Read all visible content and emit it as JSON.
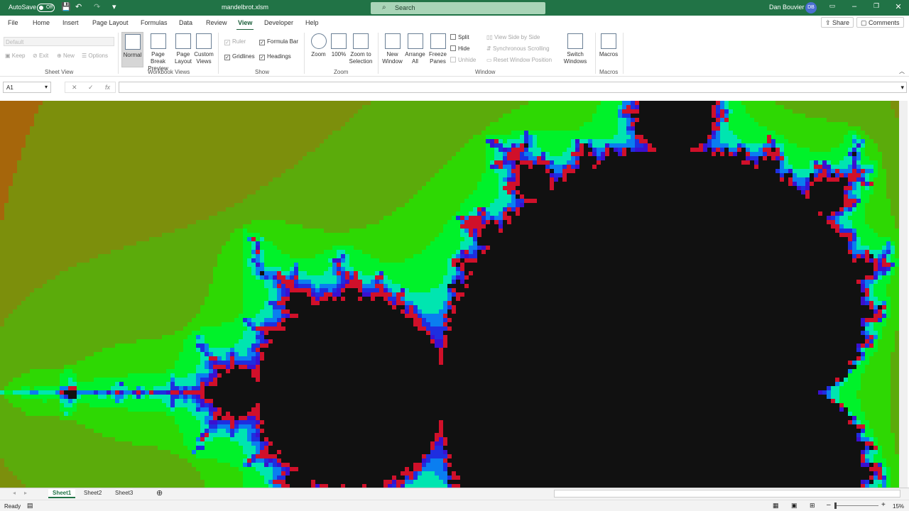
{
  "titlebar": {
    "autosave": "AutoSave",
    "autosave_state": "Off",
    "filename": "mandelbrot.xlsm",
    "search": "Search",
    "user": "Dan Bouvier",
    "initials": "DB"
  },
  "tabs": [
    "File",
    "Home",
    "Insert",
    "Page Layout",
    "Formulas",
    "Data",
    "Review",
    "View",
    "Developer",
    "Help"
  ],
  "active_tab": "View",
  "share": "Share",
  "comments": "Comments",
  "ribbon": {
    "sheet_view": {
      "dropdown": "Default",
      "keep": "Keep",
      "exit": "Exit",
      "new": "New",
      "options": "Options",
      "label": "Sheet View"
    },
    "workbook_views": {
      "normal": "Normal",
      "page_break": "Page Break Preview",
      "page_layout": "Page Layout",
      "custom": "Custom Views",
      "label": "Workbook Views"
    },
    "show": {
      "ruler": "Ruler",
      "formula_bar": "Formula Bar",
      "gridlines": "Gridlines",
      "headings": "Headings",
      "label": "Show"
    },
    "zoom": {
      "zoom": "Zoom",
      "hundred": "100%",
      "selection": "Zoom to Selection",
      "label": "Zoom"
    },
    "window": {
      "new_window": "New Window",
      "arrange_all": "Arrange All",
      "freeze": "Freeze Panes",
      "split": "Split",
      "hide": "Hide",
      "unhide": "Unhide",
      "side_by_side": "View Side by Side",
      "sync": "Synchronous Scrolling",
      "reset": "Reset Window Position",
      "switch": "Switch Windows",
      "label": "Window"
    },
    "macros": {
      "macros": "Macros",
      "label": "Macros"
    }
  },
  "formula": {
    "cell": "A1",
    "fx": "fx"
  },
  "sheets": [
    "Sheet1",
    "Sheet2",
    "Sheet3"
  ],
  "status": {
    "ready": "Ready",
    "zoom": "15%"
  },
  "fractal": {
    "colors": [
      "#d33a0f",
      "#c64d09",
      "#a6660b",
      "#7c8f0c",
      "#5bab0b",
      "#2ed803",
      "#00f22a",
      "#00e5b0",
      "#0a7ef0",
      "#1e2ee0",
      "#3a10d0",
      "#d0102a"
    ],
    "set_color": "#111111"
  }
}
